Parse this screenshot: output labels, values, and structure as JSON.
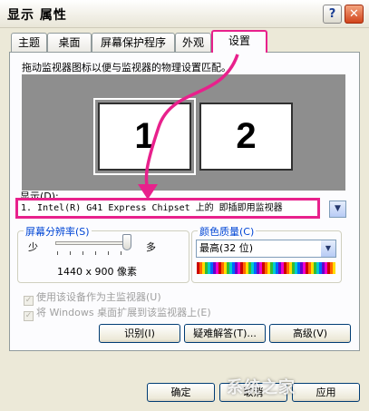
{
  "window": {
    "title": "显示 属性",
    "help_label": "?",
    "close_label": "✕"
  },
  "tabs": [
    "主题",
    "桌面",
    "屏幕保护程序",
    "外观",
    "设置"
  ],
  "active_tab": "设置",
  "settings": {
    "instruction": "拖动监视器图标以便与监视器的物理设置匹配。",
    "monitors": [
      "1",
      "2"
    ],
    "display_label": "显示(D):",
    "display_value": "1. Intel(R) G41 Express Chipset 上的 即插即用监视器",
    "resolution": {
      "label": "屏幕分辨率(S)",
      "less": "少",
      "more": "多",
      "value": "1440 x 900 像素",
      "slider_position": 1.0
    },
    "color_quality": {
      "label": "颜色质量(C)",
      "value": "最高(32 位)"
    },
    "checkbox_primary": "使用该设备作为主监视器(U)",
    "checkbox_extend": "将 Windows 桌面扩展到该监视器上(E)",
    "buttons": {
      "identify": "识别(I)",
      "troubleshoot": "疑难解答(T)...",
      "advanced": "高级(V)"
    }
  },
  "footer": {
    "ok": "确定",
    "cancel": "取消",
    "apply": "应用"
  },
  "watermark": "系统之家",
  "colors": {
    "annotation": "#e8218c",
    "monitor_bg": "#8e8e8e",
    "group_title": "#0046d5"
  }
}
